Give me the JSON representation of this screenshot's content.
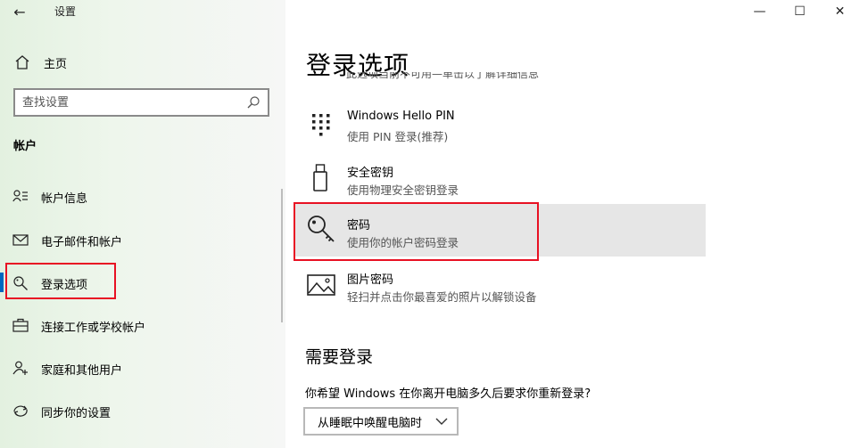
{
  "window": {
    "title": "设置",
    "back_glyph": "←",
    "minimize_glyph": "—",
    "maximize_glyph": "☐",
    "close_glyph": "✕"
  },
  "sidebar": {
    "home_label": "主页",
    "search_placeholder": "查找设置",
    "section_header": "帐户",
    "items": [
      {
        "label": "帐户信息",
        "icon": "account-info-icon"
      },
      {
        "label": "电子邮件和帐户",
        "icon": "mail-icon"
      },
      {
        "label": "登录选项",
        "icon": "key-icon",
        "active": true
      },
      {
        "label": "连接工作或学校帐户",
        "icon": "briefcase-icon"
      },
      {
        "label": "家庭和其他用户",
        "icon": "person-add-icon"
      },
      {
        "label": "同步你的设置",
        "icon": "sync-icon"
      }
    ]
  },
  "main": {
    "page_title": "登录选项",
    "cut_off_text": "此选项当前不可用—单击以了解详细信息",
    "options": [
      {
        "title": "Windows Hello PIN",
        "description": "使用 PIN 登录(推荐)",
        "icon": "pin-keypad-icon"
      },
      {
        "title": "安全密钥",
        "description": "使用物理安全密钥登录",
        "icon": "usb-key-icon"
      },
      {
        "title": "密码",
        "description": "使用你的帐户密码登录",
        "icon": "key-icon",
        "selected": true
      },
      {
        "title": "图片密码",
        "description": "轻扫并点击你最喜爱的照片以解锁设备",
        "icon": "picture-icon"
      }
    ],
    "require_signin": {
      "heading": "需要登录",
      "question": "你希望 Windows 在你离开电脑多久后要求你重新登录?",
      "selected_value": "从睡眠中唤醒电脑时"
    }
  },
  "colors": {
    "accent": "#0067c0",
    "highlight_box": "#e81123",
    "selected_bg": "#e6e6e6"
  }
}
